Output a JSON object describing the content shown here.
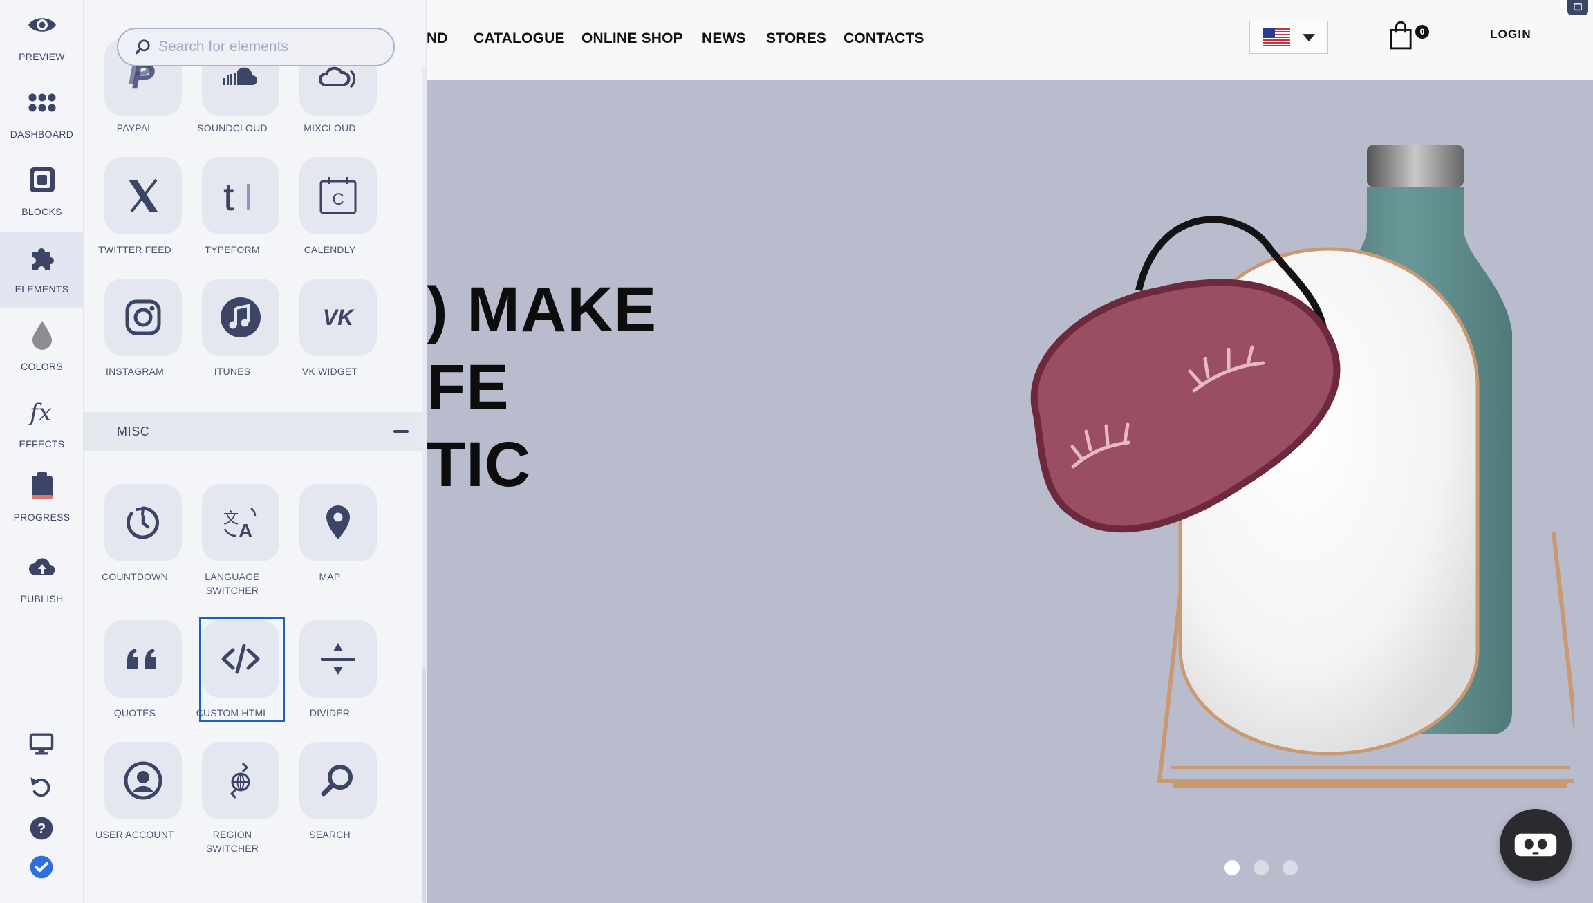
{
  "rail": {
    "items": [
      {
        "label": "PREVIEW",
        "icon": "eye-icon"
      },
      {
        "label": "DASHBOARD",
        "icon": "dots-grid-icon"
      },
      {
        "label": "BLOCKS",
        "icon": "block-square-icon"
      },
      {
        "label": "ELEMENTS",
        "icon": "puzzle-icon"
      },
      {
        "label": "COLORS",
        "icon": "drop-icon"
      },
      {
        "label": "EFFECTS",
        "icon": "fx-icon"
      },
      {
        "label": "PROGRESS",
        "icon": "clipboard-icon"
      },
      {
        "label": "PUBLISH",
        "icon": "cloud-upload-icon"
      }
    ],
    "active": "ELEMENTS",
    "bottom_icons": [
      "monitor-icon",
      "undo-icon",
      "help-icon",
      "check-circle-icon"
    ]
  },
  "panel": {
    "search_placeholder": "Search for elements",
    "top_tiles": [
      {
        "label": "PAYPAL",
        "icon": "paypal-icon"
      },
      {
        "label": "SOUNDCLOUD",
        "icon": "soundcloud-icon"
      },
      {
        "label": "MIXCLOUD",
        "icon": "mixcloud-icon"
      },
      {
        "label": "TWITTER FEED",
        "icon": "x-logo-icon"
      },
      {
        "label": "TYPEFORM",
        "icon": "typeform-icon"
      },
      {
        "label": "CALENDLY",
        "icon": "calendly-icon"
      },
      {
        "label": "INSTAGRAM",
        "icon": "instagram-icon"
      },
      {
        "label": "ITUNES",
        "icon": "music-note-icon"
      },
      {
        "label": "VK WIDGET",
        "icon": "vk-icon"
      }
    ],
    "misc_header": "MISC",
    "misc_tiles": [
      {
        "label": "COUNTDOWN",
        "icon": "countdown-icon"
      },
      {
        "label": "LANGUAGE SWITCHER",
        "icon": "translate-icon"
      },
      {
        "label": "MAP",
        "icon": "map-pin-icon"
      },
      {
        "label": "QUOTES",
        "icon": "quote-icon"
      },
      {
        "label": "CUSTOM HTML",
        "icon": "code-icon"
      },
      {
        "label": "DIVIDER",
        "icon": "divider-icon"
      },
      {
        "label": "USER ACCOUNT",
        "icon": "user-circle-icon"
      },
      {
        "label": "REGION SWITCHER",
        "icon": "globe-arrows-icon"
      },
      {
        "label": "SEARCH",
        "icon": "search-icon"
      }
    ],
    "selected": "CUSTOM HTML"
  },
  "site": {
    "nav": [
      "ND",
      "CATALOGUE",
      "ONLINE SHOP",
      "NEWS",
      "STORES",
      "CONTACTS"
    ],
    "cart_count": "0",
    "login": "LOGIN",
    "hero_lines": [
      ") MAKE",
      "FE",
      "TIC"
    ],
    "slider": {
      "count": 3,
      "active": 1
    },
    "colors": {
      "hero_bg": "#b9bccd",
      "bottle": "#5f8c8c",
      "mask": "#9a4e62",
      "accent": "#1e5fc4"
    }
  }
}
